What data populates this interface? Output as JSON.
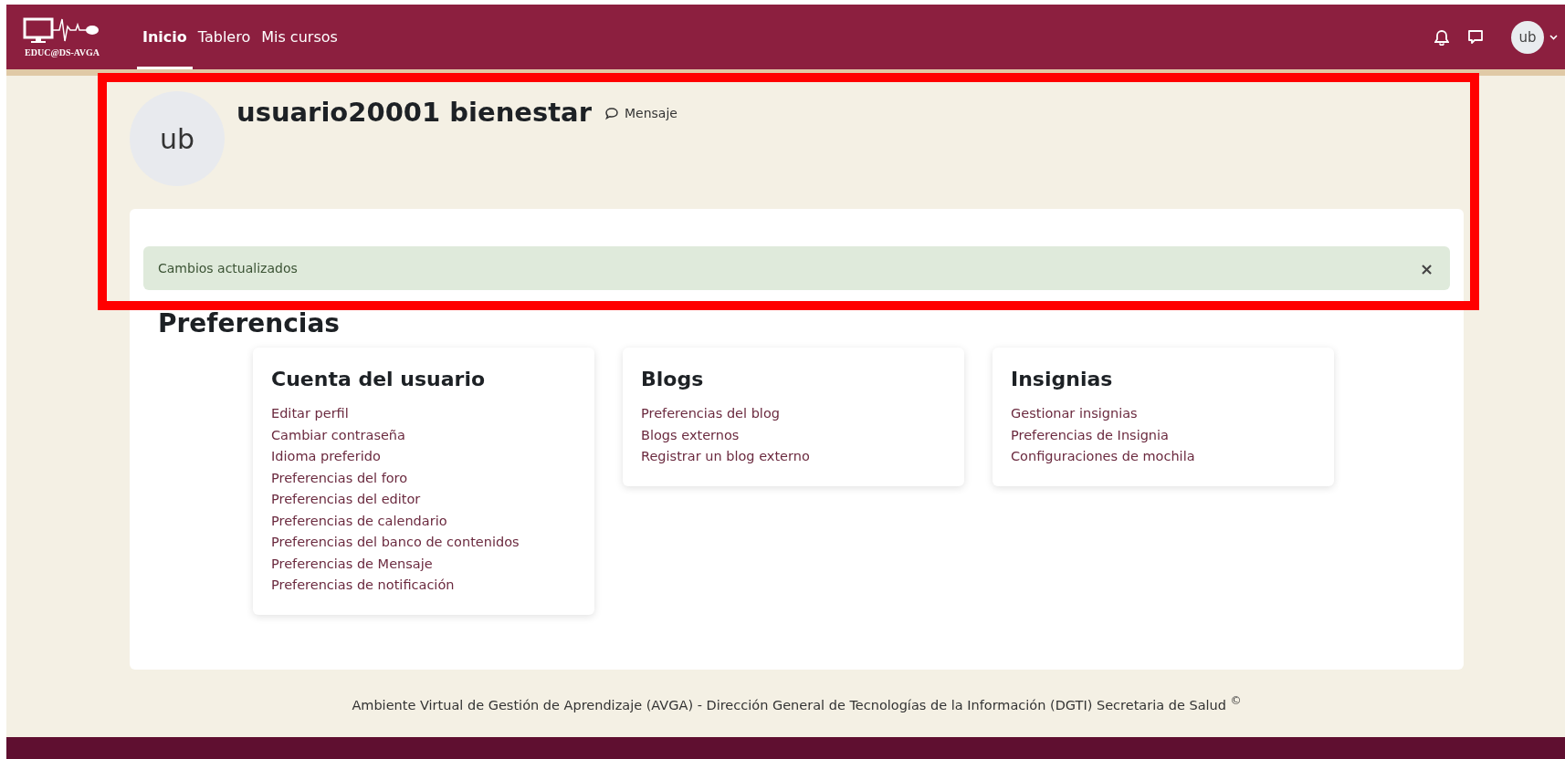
{
  "navbar": {
    "logo_text": "EDUC@DS-AVGA",
    "links": [
      {
        "label": "Inicio",
        "selected": true
      },
      {
        "label": "Tablero",
        "selected": false
      },
      {
        "label": "Mis cursos",
        "selected": false
      }
    ],
    "user_initials": "ub"
  },
  "profile": {
    "initials": "ub",
    "name": "usuario20001 bienestar",
    "message_link": "Mensaje"
  },
  "alert": {
    "text": "Cambios actualizados",
    "close": "×"
  },
  "preferences": {
    "title": "Preferencias",
    "cards": [
      {
        "title": "Cuenta del usuario",
        "links": [
          "Editar perfil",
          "Cambiar contraseña",
          "Idioma preferido",
          "Preferencias del foro",
          "Preferencias del editor",
          "Preferencias de calendario",
          "Preferencias del banco de contenidos",
          "Preferencias de Mensaje",
          "Preferencias de notificación"
        ]
      },
      {
        "title": "Blogs",
        "links": [
          "Preferencias del blog",
          "Blogs externos",
          "Registrar un blog externo"
        ]
      },
      {
        "title": "Insignias",
        "links": [
          "Gestionar insignias",
          "Preferencias de Insignia",
          "Configuraciones de mochila"
        ]
      }
    ]
  },
  "footer": {
    "text": "Ambiente Virtual de Gestión de Aprendizaje (AVGA) - Dirección General de Tecnologías de la Información (DGTI) Secretaria de Salud $^{©}$"
  }
}
